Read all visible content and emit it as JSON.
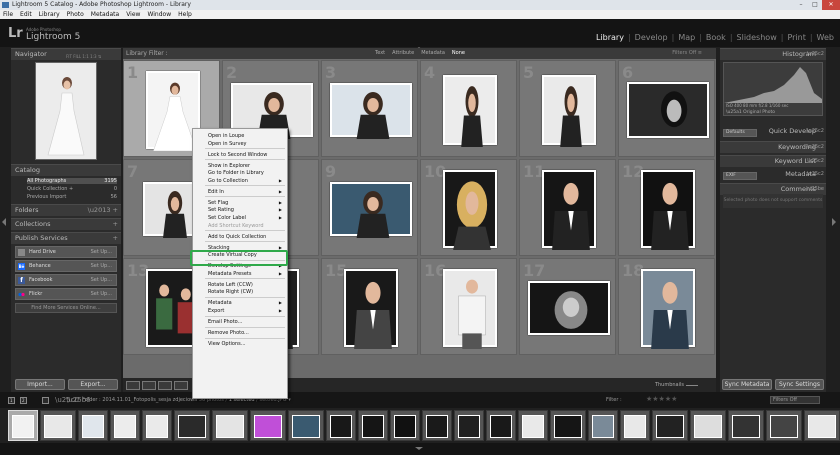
{
  "window": {
    "title": "Lightroom 5 Catalog - Adobe Photoshop Lightroom - Library",
    "min": "–",
    "max": "□",
    "close": "✕"
  },
  "menubar": [
    "File",
    "Edit",
    "Library",
    "Photo",
    "Metadata",
    "View",
    "Window",
    "Help"
  ],
  "identity": {
    "logo": "Lr",
    "small": "Adobe Photoshop",
    "name": "Lightroom 5"
  },
  "modules": [
    {
      "label": "Library",
      "active": true
    },
    {
      "label": "Develop"
    },
    {
      "label": "Map"
    },
    {
      "label": "Book"
    },
    {
      "label": "Slideshow"
    },
    {
      "label": "Print"
    },
    {
      "label": "Web"
    }
  ],
  "left": {
    "navigator": {
      "title": "Navigator",
      "opts": "FIT  FILL  1:1  1:3 ⇅"
    },
    "catalog": {
      "title": "Catalog",
      "rows": [
        {
          "label": "All Photographs",
          "count": "3195"
        },
        {
          "label": "Quick Collection +",
          "count": "0"
        },
        {
          "label": "Previous Import",
          "count": "56"
        }
      ]
    },
    "folders": "Folders",
    "collections": "Collections",
    "publish": {
      "title": "Publish Services",
      "services": [
        {
          "name": "Hard Drive",
          "set": "Set Up...",
          "color": "#888888"
        },
        {
          "name": "Behance",
          "set": "Set Up...",
          "color": "#1769ff",
          "icon": "Bē"
        },
        {
          "name": "Facebook",
          "set": "Set Up...",
          "color": "#3b5998",
          "icon": "f"
        },
        {
          "name": "Flickr",
          "set": "Set Up...",
          "color": "#ff0084"
        }
      ],
      "findmore": "Find More Services Online..."
    },
    "import_label": "Import...",
    "export_label": "Export..."
  },
  "center": {
    "filterbar": {
      "title": "Library Filter :",
      "options": [
        "Text",
        "Attribute",
        "Metadata",
        "None"
      ],
      "active": "None",
      "filters": "Filters Off ≡"
    },
    "grid_numbers": [
      "1",
      "2",
      "3",
      "4",
      "5",
      "6",
      "7",
      "8",
      "9",
      "10",
      "11",
      "12",
      "13",
      "14",
      "15",
      "16",
      "17",
      "18"
    ],
    "toolbar": {
      "thumbnails": "Thumbnails"
    }
  },
  "right": {
    "histogram": {
      "title": "Histogram",
      "info": "ISO 400   80 mm   f/2.8   1/160 sec",
      "original": "Original Photo"
    },
    "quickdevelop": {
      "title": "Quick Develop",
      "preset": "Defaults"
    },
    "keywording": "Keywording",
    "keywordlist": "Keyword List",
    "metadata": {
      "title": "Metadata",
      "preset": "EXIF"
    },
    "comments": {
      "title": "Comments",
      "text": "Selected photo does not support comments"
    },
    "sync_meta": "Sync Metadata",
    "sync_settings": "Sync Settings"
  },
  "filmbar": {
    "pages": [
      "1",
      "2"
    ],
    "path_pre": "Folder : 2014.11.01_Fotopolis_sesja zdjeciowa",
    "path_mid": "   56 photos /",
    "path_sel": " 1 selected ",
    "path_file": "/ settled.JPG ▾",
    "filter": "Filter :",
    "stars": "★★★★★",
    "filters_off": "Filters Off"
  },
  "context_menu": {
    "items": [
      {
        "label": "Open in Loupe"
      },
      {
        "label": "Open in Survey"
      },
      {
        "sep": true
      },
      {
        "label": "Lock to Second Window"
      },
      {
        "sep": true
      },
      {
        "label": "Show in Explorer"
      },
      {
        "label": "Go to Folder in Library"
      },
      {
        "label": "Go to Collection",
        "sub": true
      },
      {
        "sep": true
      },
      {
        "label": "Edit In",
        "sub": true
      },
      {
        "sep": true
      },
      {
        "label": "Set Flag",
        "sub": true
      },
      {
        "label": "Set Rating",
        "sub": true
      },
      {
        "label": "Set Color Label",
        "sub": true
      },
      {
        "label": "Add Shortcut Keyword",
        "disabled": true
      },
      {
        "sep": true
      },
      {
        "label": "Add to Quick Collection",
        "highlight": true
      },
      {
        "sep": true
      },
      {
        "label": "Stacking",
        "sub": true
      },
      {
        "label": "Create Virtual Copy"
      },
      {
        "sep": true
      },
      {
        "label": "Develop Settings",
        "sub": true
      },
      {
        "label": "Metadata Presets",
        "sub": true
      },
      {
        "sep": true
      },
      {
        "label": "Rotate Left (CCW)"
      },
      {
        "label": "Rotate Right (CW)"
      },
      {
        "sep": true
      },
      {
        "label": "Metadata",
        "sub": true
      },
      {
        "label": "Export",
        "sub": true
      },
      {
        "sep": true
      },
      {
        "label": "Email Photo..."
      },
      {
        "sep": true
      },
      {
        "label": "Remove Photo..."
      },
      {
        "sep": true
      },
      {
        "label": "View Options..."
      }
    ],
    "highlight_color": "#2fa94a"
  }
}
